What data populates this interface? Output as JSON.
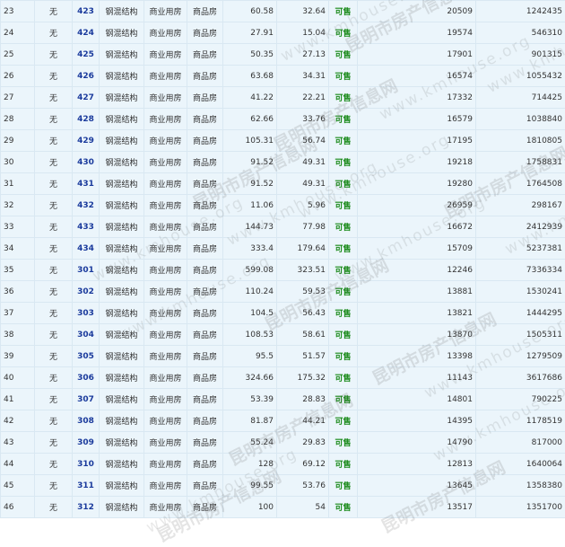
{
  "colors": {
    "status_available": "#1a8a1a",
    "room_link": "#1a3a9c",
    "row_bg": "#ebf5fb"
  },
  "watermark": {
    "text": "昆明市房产信息网",
    "url": "www.kmhouse.org"
  },
  "rows": [
    {
      "idx": "23",
      "pre": "无",
      "room": "423",
      "structure": "钢混结构",
      "use": "商业用房",
      "type": "商品房",
      "area_total": "60.58",
      "area_inner": "32.64",
      "status": "可售",
      "unit_price": "20509",
      "total_price": "1242435"
    },
    {
      "idx": "24",
      "pre": "无",
      "room": "424",
      "structure": "钢混结构",
      "use": "商业用房",
      "type": "商品房",
      "area_total": "27.91",
      "area_inner": "15.04",
      "status": "可售",
      "unit_price": "19574",
      "total_price": "546310"
    },
    {
      "idx": "25",
      "pre": "无",
      "room": "425",
      "structure": "钢混结构",
      "use": "商业用房",
      "type": "商品房",
      "area_total": "50.35",
      "area_inner": "27.13",
      "status": "可售",
      "unit_price": "17901",
      "total_price": "901315"
    },
    {
      "idx": "26",
      "pre": "无",
      "room": "426",
      "structure": "钢混结构",
      "use": "商业用房",
      "type": "商品房",
      "area_total": "63.68",
      "area_inner": "34.31",
      "status": "可售",
      "unit_price": "16574",
      "total_price": "1055432"
    },
    {
      "idx": "27",
      "pre": "无",
      "room": "427",
      "structure": "钢混结构",
      "use": "商业用房",
      "type": "商品房",
      "area_total": "41.22",
      "area_inner": "22.21",
      "status": "可售",
      "unit_price": "17332",
      "total_price": "714425"
    },
    {
      "idx": "28",
      "pre": "无",
      "room": "428",
      "structure": "钢混结构",
      "use": "商业用房",
      "type": "商品房",
      "area_total": "62.66",
      "area_inner": "33.76",
      "status": "可售",
      "unit_price": "16579",
      "total_price": "1038840"
    },
    {
      "idx": "29",
      "pre": "无",
      "room": "429",
      "structure": "钢混结构",
      "use": "商业用房",
      "type": "商品房",
      "area_total": "105.31",
      "area_inner": "56.74",
      "status": "可售",
      "unit_price": "17195",
      "total_price": "1810805"
    },
    {
      "idx": "30",
      "pre": "无",
      "room": "430",
      "structure": "钢混结构",
      "use": "商业用房",
      "type": "商品房",
      "area_total": "91.52",
      "area_inner": "49.31",
      "status": "可售",
      "unit_price": "19218",
      "total_price": "1758831"
    },
    {
      "idx": "31",
      "pre": "无",
      "room": "431",
      "structure": "钢混结构",
      "use": "商业用房",
      "type": "商品房",
      "area_total": "91.52",
      "area_inner": "49.31",
      "status": "可售",
      "unit_price": "19280",
      "total_price": "1764508"
    },
    {
      "idx": "32",
      "pre": "无",
      "room": "432",
      "structure": "钢混结构",
      "use": "商业用房",
      "type": "商品房",
      "area_total": "11.06",
      "area_inner": "5.96",
      "status": "可售",
      "unit_price": "26959",
      "total_price": "298167"
    },
    {
      "idx": "33",
      "pre": "无",
      "room": "433",
      "structure": "钢混结构",
      "use": "商业用房",
      "type": "商品房",
      "area_total": "144.73",
      "area_inner": "77.98",
      "status": "可售",
      "unit_price": "16672",
      "total_price": "2412939"
    },
    {
      "idx": "34",
      "pre": "无",
      "room": "434",
      "structure": "钢混结构",
      "use": "商业用房",
      "type": "商品房",
      "area_total": "333.4",
      "area_inner": "179.64",
      "status": "可售",
      "unit_price": "15709",
      "total_price": "5237381"
    },
    {
      "idx": "35",
      "pre": "无",
      "room": "301",
      "structure": "钢混结构",
      "use": "商业用房",
      "type": "商品房",
      "area_total": "599.08",
      "area_inner": "323.51",
      "status": "可售",
      "unit_price": "12246",
      "total_price": "7336334"
    },
    {
      "idx": "36",
      "pre": "无",
      "room": "302",
      "structure": "钢混结构",
      "use": "商业用房",
      "type": "商品房",
      "area_total": "110.24",
      "area_inner": "59.53",
      "status": "可售",
      "unit_price": "13881",
      "total_price": "1530241"
    },
    {
      "idx": "37",
      "pre": "无",
      "room": "303",
      "structure": "钢混结构",
      "use": "商业用房",
      "type": "商品房",
      "area_total": "104.5",
      "area_inner": "56.43",
      "status": "可售",
      "unit_price": "13821",
      "total_price": "1444295"
    },
    {
      "idx": "38",
      "pre": "无",
      "room": "304",
      "structure": "钢混结构",
      "use": "商业用房",
      "type": "商品房",
      "area_total": "108.53",
      "area_inner": "58.61",
      "status": "可售",
      "unit_price": "13870",
      "total_price": "1505311"
    },
    {
      "idx": "39",
      "pre": "无",
      "room": "305",
      "structure": "钢混结构",
      "use": "商业用房",
      "type": "商品房",
      "area_total": "95.5",
      "area_inner": "51.57",
      "status": "可售",
      "unit_price": "13398",
      "total_price": "1279509"
    },
    {
      "idx": "40",
      "pre": "无",
      "room": "306",
      "structure": "钢混结构",
      "use": "商业用房",
      "type": "商品房",
      "area_total": "324.66",
      "area_inner": "175.32",
      "status": "可售",
      "unit_price": "11143",
      "total_price": "3617686"
    },
    {
      "idx": "41",
      "pre": "无",
      "room": "307",
      "structure": "钢混结构",
      "use": "商业用房",
      "type": "商品房",
      "area_total": "53.39",
      "area_inner": "28.83",
      "status": "可售",
      "unit_price": "14801",
      "total_price": "790225"
    },
    {
      "idx": "42",
      "pre": "无",
      "room": "308",
      "structure": "钢混结构",
      "use": "商业用房",
      "type": "商品房",
      "area_total": "81.87",
      "area_inner": "44.21",
      "status": "可售",
      "unit_price": "14395",
      "total_price": "1178519"
    },
    {
      "idx": "43",
      "pre": "无",
      "room": "309",
      "structure": "钢混结构",
      "use": "商业用房",
      "type": "商品房",
      "area_total": "55.24",
      "area_inner": "29.83",
      "status": "可售",
      "unit_price": "14790",
      "total_price": "817000"
    },
    {
      "idx": "44",
      "pre": "无",
      "room": "310",
      "structure": "钢混结构",
      "use": "商业用房",
      "type": "商品房",
      "area_total": "128",
      "area_inner": "69.12",
      "status": "可售",
      "unit_price": "12813",
      "total_price": "1640064"
    },
    {
      "idx": "45",
      "pre": "无",
      "room": "311",
      "structure": "钢混结构",
      "use": "商业用房",
      "type": "商品房",
      "area_total": "99.55",
      "area_inner": "53.76",
      "status": "可售",
      "unit_price": "13645",
      "total_price": "1358380"
    },
    {
      "idx": "46",
      "pre": "无",
      "room": "312",
      "structure": "钢混结构",
      "use": "商业用房",
      "type": "商品房",
      "area_total": "100",
      "area_inner": "54",
      "status": "可售",
      "unit_price": "13517",
      "total_price": "1351700"
    }
  ]
}
